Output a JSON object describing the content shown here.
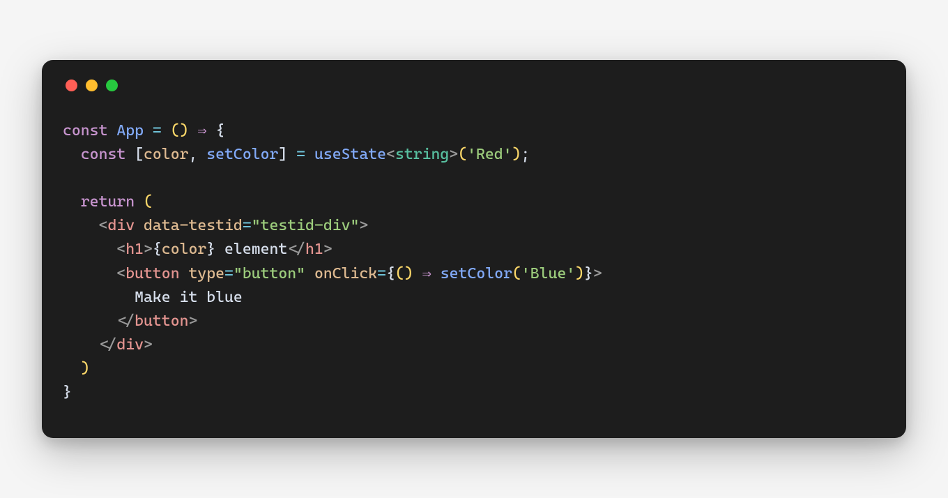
{
  "window": {
    "traffic_lights": {
      "close_color": "#ff5f56",
      "minimize_color": "#ffbd2e",
      "maximize_color": "#27c93f"
    }
  },
  "code": {
    "line1": {
      "t1": "const",
      "t2": " ",
      "t3": "App",
      "t4": " ",
      "t5": "=",
      "t6": " ",
      "t7": "(",
      "t8": ")",
      "t9": " ",
      "t10": "⇒",
      "t11": " ",
      "t12": "{"
    },
    "line2": {
      "indent": "  ",
      "t1": "const",
      "t2": " ",
      "t3": "[",
      "t4": "color",
      "t5": ",",
      "t6": " ",
      "t7": "setColor",
      "t8": "]",
      "t9": " ",
      "t10": "=",
      "t11": " ",
      "t12": "useState",
      "t13": "<",
      "t14": "string",
      "t15": ">",
      "t16": "(",
      "t17": "'Red'",
      "t18": ")",
      "t19": ";"
    },
    "line3": {
      "blank": ""
    },
    "line4": {
      "indent": "  ",
      "t1": "return",
      "t2": " ",
      "t3": "("
    },
    "line5": {
      "indent": "    ",
      "t1": "<",
      "t2": "div",
      "t3": " ",
      "t4": "data-testid",
      "t5": "=",
      "t6": "\"testid-div\"",
      "t7": ">"
    },
    "line6": {
      "indent": "      ",
      "t1": "<",
      "t2": "h1",
      "t3": ">",
      "t4": "{",
      "t5": "color",
      "t6": "}",
      "t7": " element",
      "t8": "</",
      "t9": "h1",
      "t10": ">"
    },
    "line7": {
      "indent": "      ",
      "t1": "<",
      "t2": "button",
      "t3": " ",
      "t4": "type",
      "t5": "=",
      "t6": "\"button\"",
      "t7": " ",
      "t8": "onClick",
      "t9": "=",
      "t10": "{",
      "t11": "(",
      "t12": ")",
      "t13": " ",
      "t14": "⇒",
      "t15": " ",
      "t16": "setColor",
      "t17": "(",
      "t18": "'Blue'",
      "t19": ")",
      "t20": "}",
      "t21": ">"
    },
    "line8": {
      "indent": "        ",
      "t1": "Make it blue"
    },
    "line9": {
      "indent": "      ",
      "t1": "</",
      "t2": "button",
      "t3": ">"
    },
    "line10": {
      "indent": "    ",
      "t1": "</",
      "t2": "div",
      "t3": ">"
    },
    "line11": {
      "indent": "  ",
      "t1": ")"
    },
    "line12": {
      "t1": "}"
    }
  }
}
